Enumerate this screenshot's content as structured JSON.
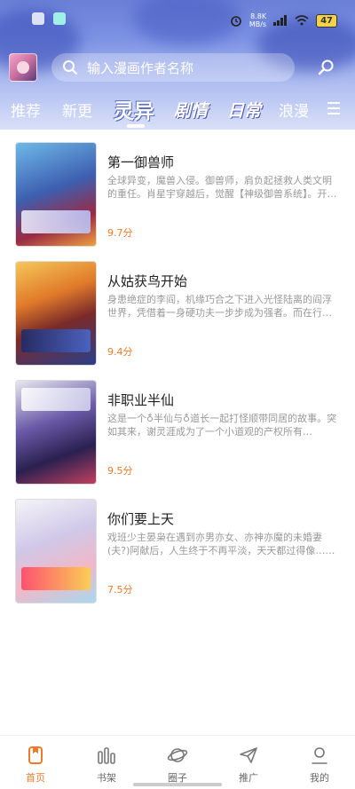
{
  "status_bar": {
    "net_speed_value": "8.8K",
    "net_speed_unit": "MB/s",
    "battery": "47"
  },
  "header": {
    "search_placeholder": "输入漫画作者名称",
    "tabs": [
      {
        "label": "推荐",
        "active": false
      },
      {
        "label": "新更",
        "active": false
      },
      {
        "label": "灵异",
        "active": true
      },
      {
        "label": "剧情",
        "active": false
      },
      {
        "label": "日常",
        "active": false
      },
      {
        "label": "浪漫",
        "active": false
      }
    ],
    "icons": {
      "search": "search-icon",
      "action": "scan-search-icon",
      "menu": "menu-icon"
    }
  },
  "comics": [
    {
      "title": "第一御兽师",
      "description": "全球异变，魔兽入侵。御兽师，肩负起拯救人类文明的重任。肖星宇穿越后，觉醒【神级御兽系统】。开启了他的御兽之路……",
      "score": "9.7分"
    },
    {
      "title": "从姑获鸟开始",
      "description": "身患绝症的李阎，机缘巧合之下进入光怪陆离的阎浮世界，凭借着一身硬功夫一步步成为强者。而在行走中……",
      "score": "9.4分"
    },
    {
      "title": "非职业半仙",
      "description": "这是一个♁半仙与♁道长一起打怪顺带同居的故事。突如其来，谢灵涯成为了一个小道观的产权所有人。……",
      "score": "9.5分"
    },
    {
      "title": "你们要上天",
      "description": "戏班少主晏枭在遇到亦男亦女、亦神亦魔的未婚妻(夫?)阿献后，人生终于不再平淡，天天都过得像……",
      "score": "7.5分"
    }
  ],
  "bottom_nav": [
    {
      "label": "首页",
      "icon": "home-icon",
      "active": true
    },
    {
      "label": "书架",
      "icon": "bookshelf-icon",
      "active": false
    },
    {
      "label": "圈子",
      "icon": "planet-icon",
      "active": false
    },
    {
      "label": "推广",
      "icon": "paper-plane-icon",
      "active": false
    },
    {
      "label": "我的",
      "icon": "profile-icon",
      "active": false
    }
  ],
  "colors": {
    "accent": "#f07a2a",
    "header_bg": "#7c92e4"
  }
}
